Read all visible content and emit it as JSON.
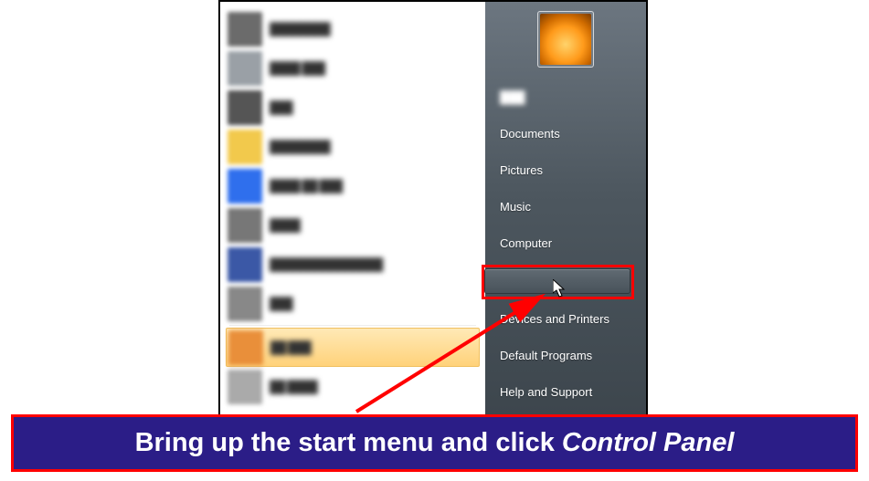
{
  "programs": [
    {
      "label": "████████"
    },
    {
      "label": "████ ███"
    },
    {
      "label": "███"
    },
    {
      "label": "████████"
    },
    {
      "label": "████ ██ ███"
    },
    {
      "label": "████"
    },
    {
      "label": "███████████████"
    },
    {
      "label": "███"
    },
    {
      "label": "██ ███",
      "hovered": true
    },
    {
      "label": "██ ████"
    }
  ],
  "right": {
    "user": "███",
    "documents": "Documents",
    "pictures": "Pictures",
    "music": "Music",
    "computer": "Computer",
    "control_panel": "Control Panel",
    "devices": "Devices and Printers",
    "default_programs": "Default Programs",
    "help": "Help and Support"
  },
  "caption_pre": "Bring up the start menu and click ",
  "caption_em": "Control Panel",
  "icon_colors": [
    "#6b6b6b",
    "#9aa0a6",
    "#555",
    "#f2c94c",
    "#2f6fed",
    "#777",
    "#3b58a6",
    "#888",
    "#e98f3a",
    "#aaa"
  ]
}
